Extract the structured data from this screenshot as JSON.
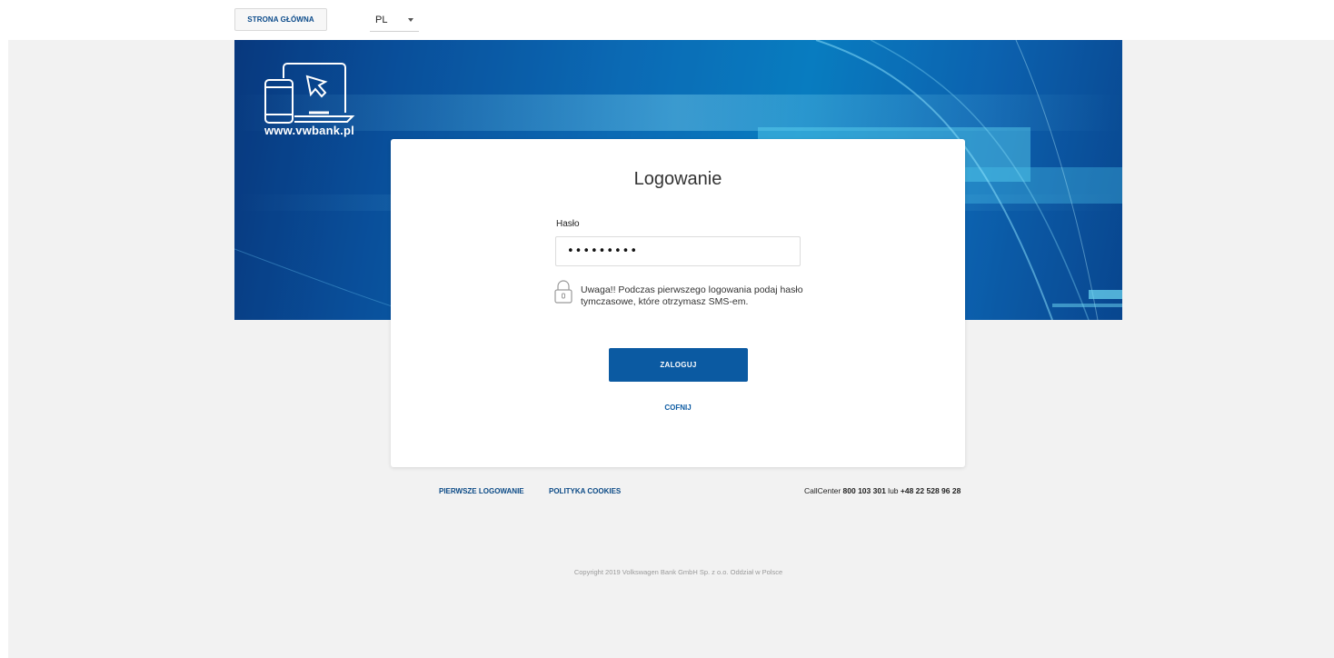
{
  "topbar": {
    "home_label": "STRONA GŁÓWNA",
    "lang_value": "PL"
  },
  "banner": {
    "url_text": "www.vwbank.pl"
  },
  "login": {
    "title": "Logowanie",
    "password_label": "Hasło",
    "password_value": "•••••••••",
    "notice": "Uwaga!! Podczas pierwszego logowania podaj hasło tymczasowe, które otrzymasz SMS-em.",
    "submit_label": "ZALOGUJ",
    "back_label": "COFNIJ"
  },
  "footer": {
    "first_login_label": "PIERWSZE LOGOWANIE",
    "cookies_label": "POLITYKA COOKIES",
    "callcenter_prefix": "CallCenter ",
    "callcenter_number1": "800 103 301",
    "callcenter_or": " lub ",
    "callcenter_number2": "+48 22 528 96 28",
    "copyright": "Copyright 2019 Volkswagen Bank GmbH Sp. z o.o. Oddział w Polsce"
  },
  "colors": {
    "brand_blue": "#0b5aa2",
    "page_bg": "#f2f2f2"
  },
  "icons": [
    "devices-icon",
    "cursor-icon",
    "lock-icon",
    "chevron-down-icon"
  ]
}
